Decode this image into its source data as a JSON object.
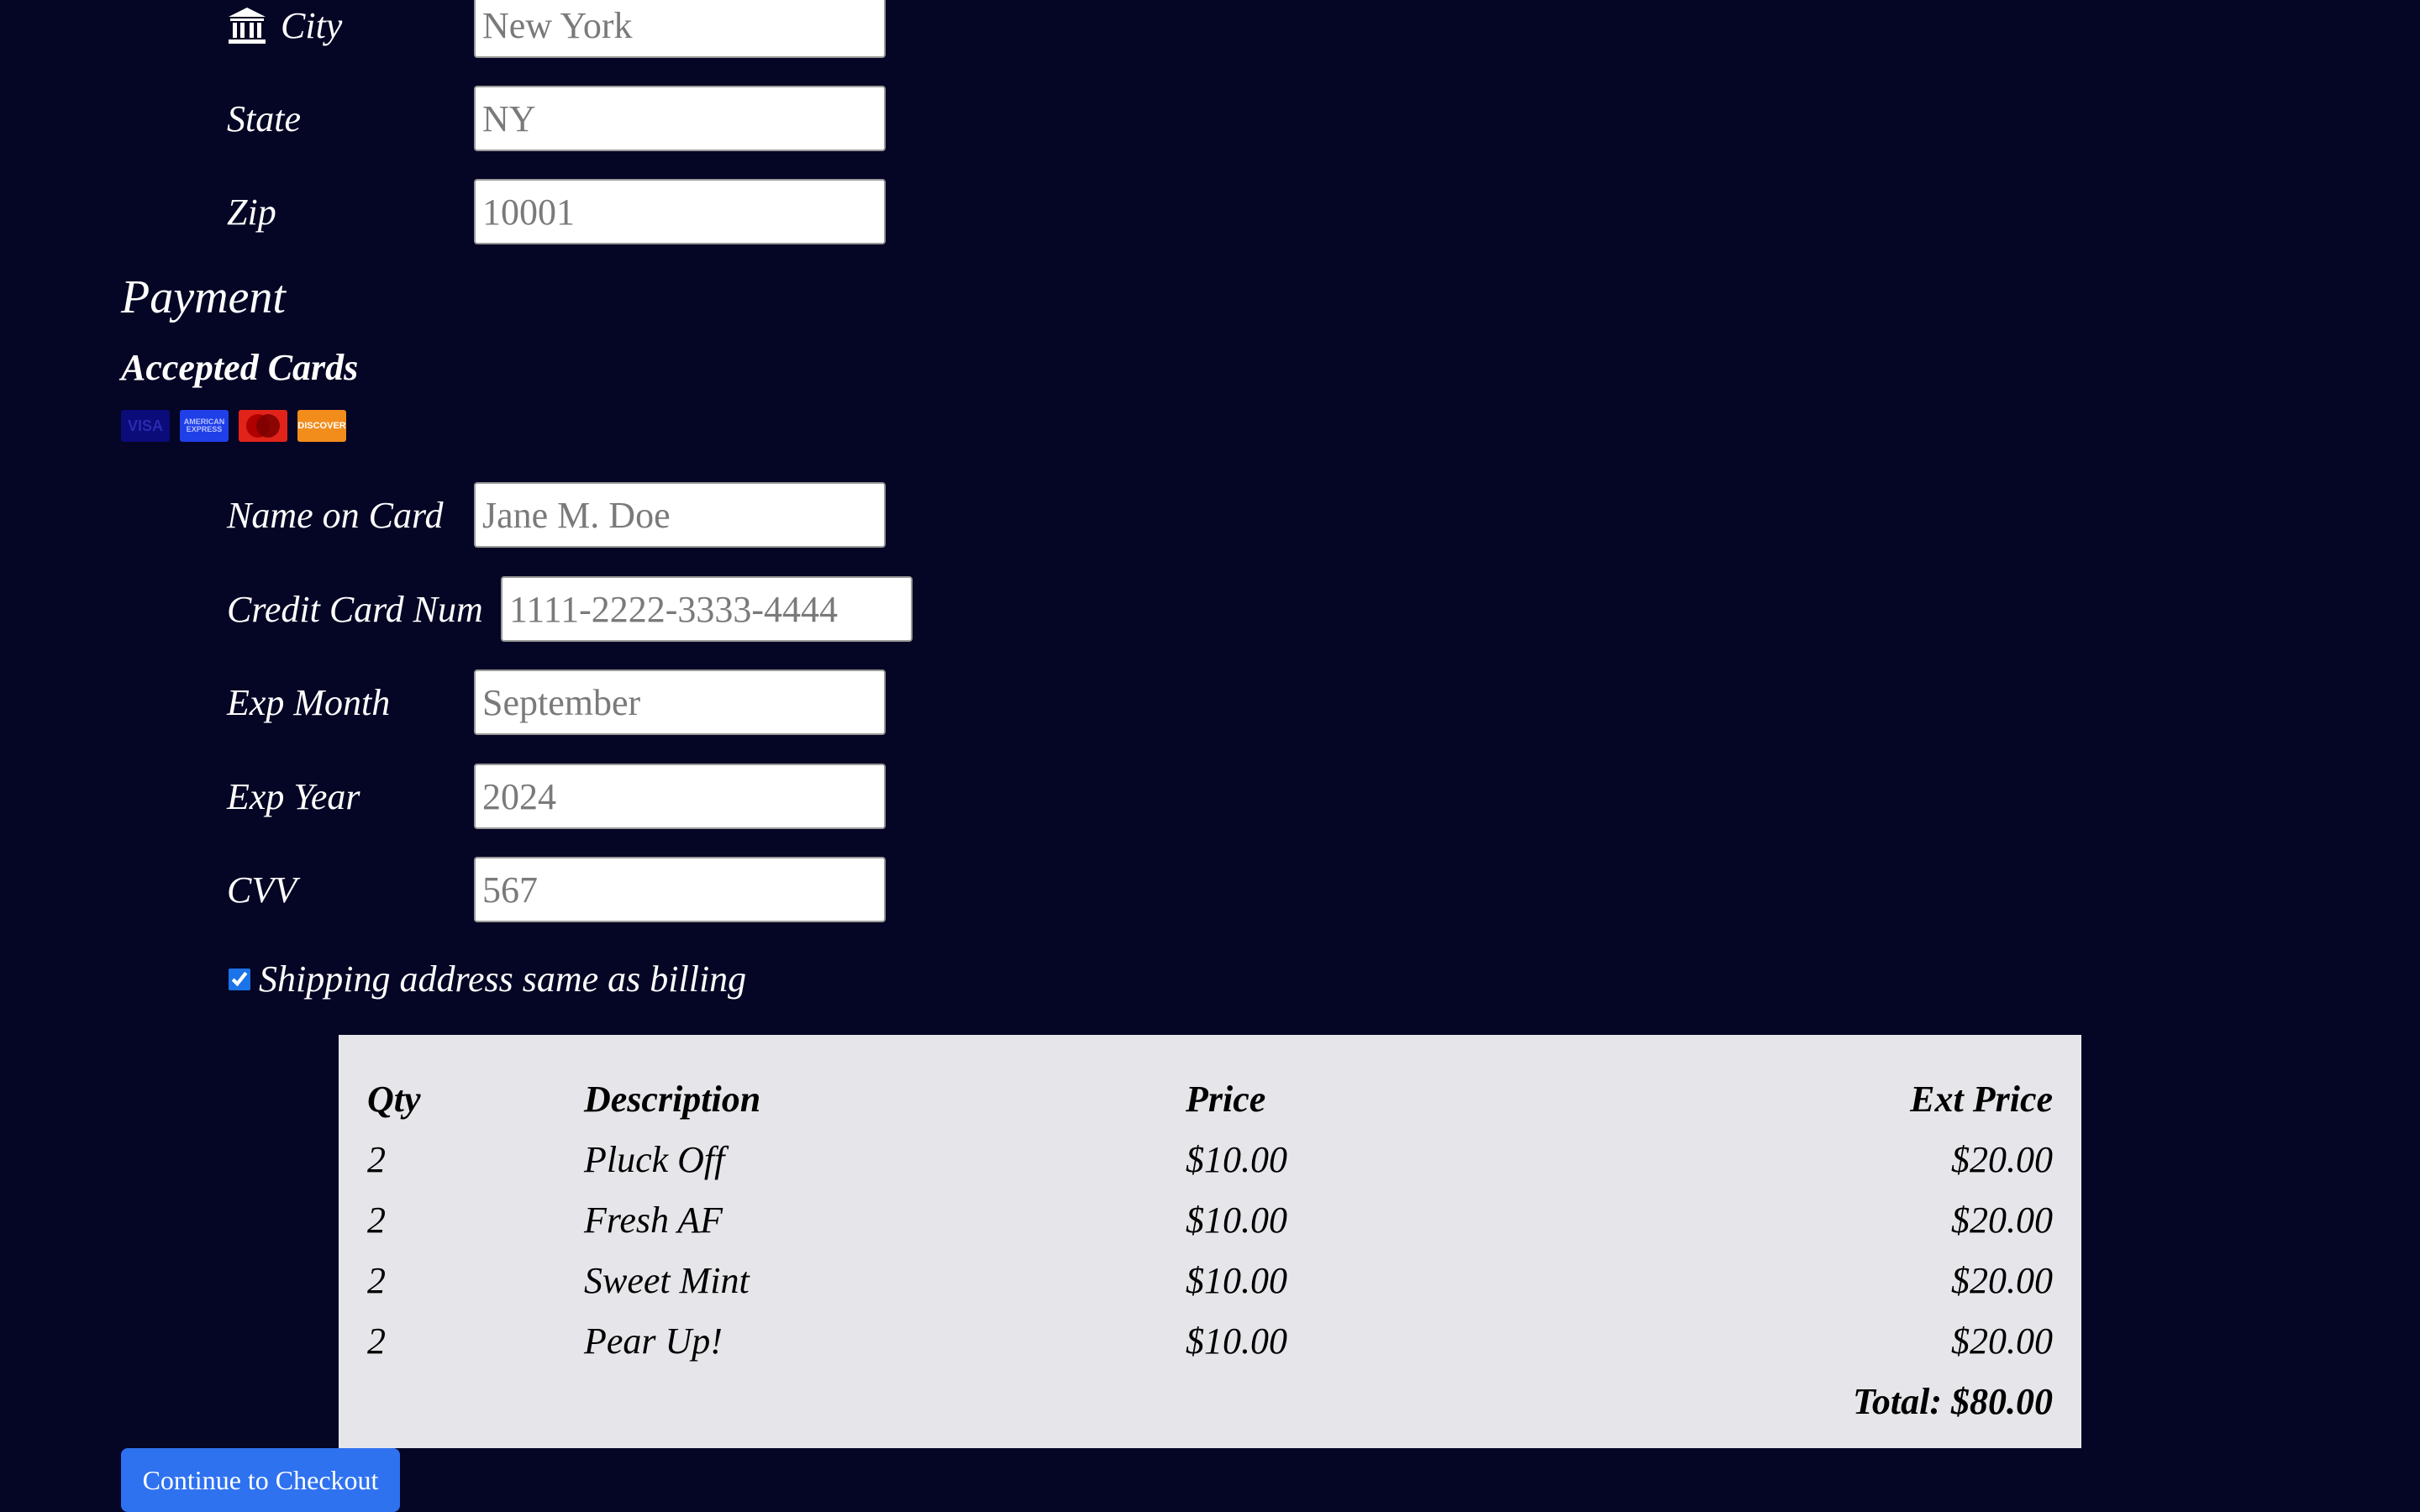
{
  "billing": {
    "city": {
      "label": "City",
      "placeholder": "New York",
      "icon": "bank-icon"
    },
    "state": {
      "label": "State",
      "placeholder": "NY"
    },
    "zip": {
      "label": "Zip",
      "placeholder": "10001"
    }
  },
  "payment": {
    "heading": "Payment",
    "accepted_cards_heading": "Accepted Cards",
    "cards": [
      {
        "name": "visa-icon",
        "text": "VISA",
        "color": "#0b0b7a"
      },
      {
        "name": "amex-icon",
        "text": "AMERICAN EXPRESS",
        "color": "#1f3fe8"
      },
      {
        "name": "mastercard-icon",
        "color": "#e2231a"
      },
      {
        "name": "discover-icon",
        "text": "DISCOVER",
        "color": "#f28c1b"
      }
    ],
    "name_on_card": {
      "label": "Name on Card",
      "placeholder": "Jane M. Doe"
    },
    "card_number": {
      "label": "Credit Card Num",
      "placeholder": "1111-2222-3333-4444"
    },
    "exp_month": {
      "label": "Exp Month",
      "placeholder": "September"
    },
    "exp_year": {
      "label": "Exp Year",
      "placeholder": "2024"
    },
    "cvv": {
      "label": "CVV",
      "placeholder": "567"
    }
  },
  "shipping_same": {
    "label": "Shipping address same as billing",
    "checked": true
  },
  "order": {
    "headers": {
      "qty": "Qty",
      "description": "Description",
      "price": "Price",
      "ext_price": "Ext Price"
    },
    "rows": [
      {
        "qty": "2",
        "description": "Pluck Off",
        "price": "$10.00",
        "ext_price": "$20.00"
      },
      {
        "qty": "2",
        "description": "Fresh AF",
        "price": "$10.00",
        "ext_price": "$20.00"
      },
      {
        "qty": "2",
        "description": "Sweet Mint",
        "price": "$10.00",
        "ext_price": "$20.00"
      },
      {
        "qty": "2",
        "description": "Pear Up!",
        "price": "$10.00",
        "ext_price": "$20.00"
      }
    ],
    "total": "Total: $80.00"
  },
  "checkout_button": "Continue to Checkout",
  "colors": {
    "background": "#050525",
    "summary_bg": "#e6e6ea",
    "button": "#2e72f0"
  }
}
